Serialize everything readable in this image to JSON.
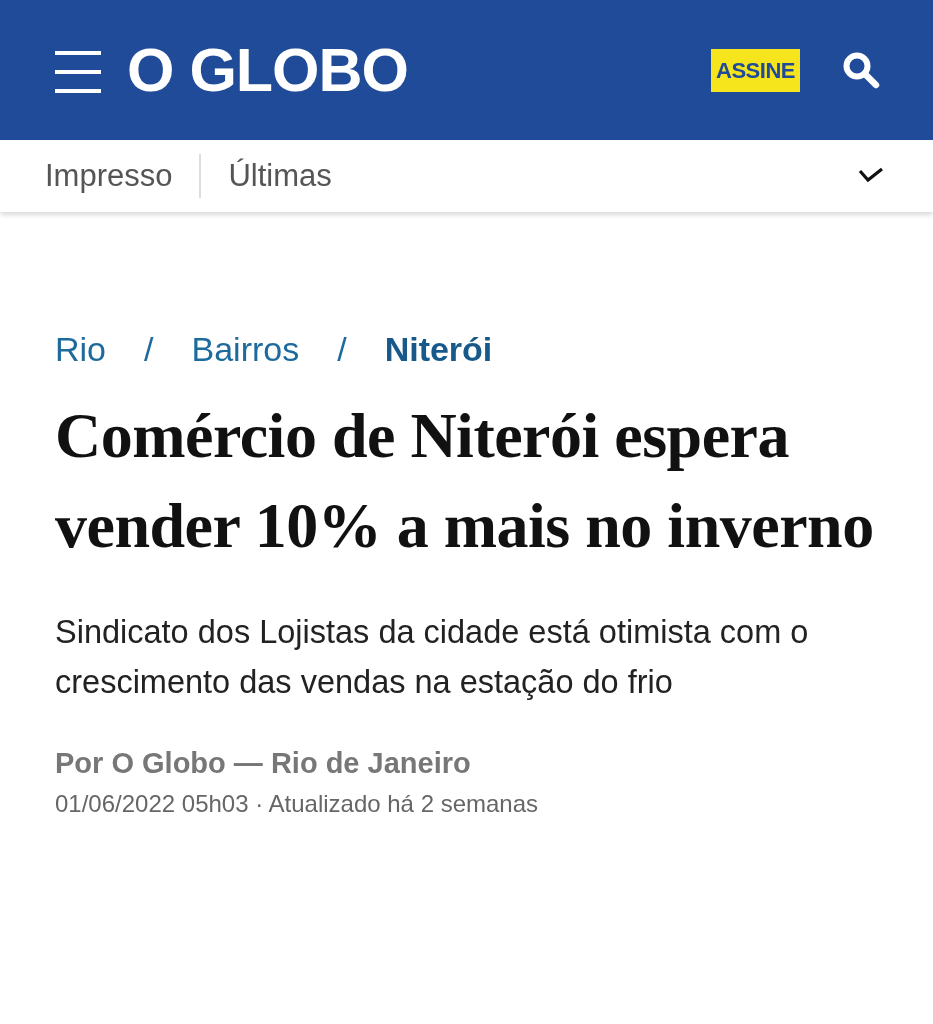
{
  "header": {
    "logo": "O GLOBO",
    "subscribe_button": "ASSINE"
  },
  "nav": {
    "items": [
      {
        "label": "Impresso"
      },
      {
        "label": "Últimas"
      }
    ]
  },
  "breadcrumb": [
    {
      "kind": "link",
      "label": "Rio",
      "selected": false
    },
    {
      "kind": "separator",
      "label": "/"
    },
    {
      "kind": "link",
      "label": "Bairros",
      "selected": false
    },
    {
      "kind": "separator",
      "label": "/"
    },
    {
      "kind": "link",
      "label": "Niterói",
      "selected": true
    }
  ],
  "article": {
    "headline": "Comércio de Niterói espera vender 10% a mais no inverno",
    "subtitle": "Sindicato dos Lojistas da cidade está otimista com o crescimento das vendas na estação do frio",
    "byline": "Por O Globo — Rio de Janeiro",
    "date": "01/06/2022 05h03 · Atualizado há 2 semanas"
  }
}
